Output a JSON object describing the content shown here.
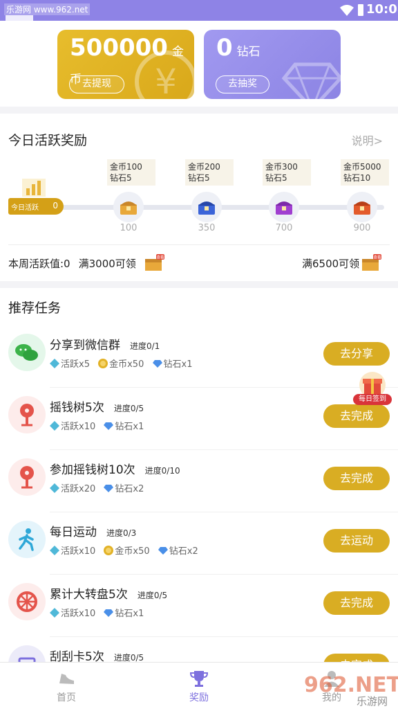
{
  "status_bar": {
    "watermark": "乐游网 www.962.net",
    "time": "10:08"
  },
  "wallet": {
    "coins": {
      "amount": "500000",
      "unit": "金币",
      "button": "去提现"
    },
    "diamonds": {
      "amount": "0",
      "unit": "钻石",
      "button": "去抽奖"
    }
  },
  "daily": {
    "title": "今日活跃奖励",
    "help": "说明>",
    "today_label": "今日活跃",
    "today_value": "0",
    "milestones": [
      {
        "coins": "金币100",
        "diamonds": "钻石5",
        "value": "100",
        "chest_color": "#e8a83a"
      },
      {
        "coins": "金币200",
        "diamonds": "钻石5",
        "value": "350",
        "chest_color": "#3b64d8"
      },
      {
        "coins": "金币300",
        "diamonds": "钻石5",
        "value": "700",
        "chest_color": "#a03fd0"
      },
      {
        "coins": "金币5000",
        "diamonds": "钻石10",
        "value": "900",
        "chest_color": "#e35a2b"
      }
    ],
    "weekly_label": "本周活跃值:0",
    "weekly_goal_1": "满3000可领",
    "weekly_goal_2": "满6500可领",
    "gift_badge": "查看"
  },
  "tasks": {
    "title": "推荐任务",
    "items": [
      {
        "name": "分享到微信群",
        "progress": "进度0/1",
        "rewards": [
          "活跃x5",
          "金币x50",
          "钻石x1"
        ],
        "reward_icons": [
          "activity-icon",
          "coin-icon",
          "diamond-icon"
        ],
        "button": "去分享",
        "icon": "wechat-icon",
        "icon_bg": "#e4f7ea"
      },
      {
        "name": "摇钱树5次",
        "progress": "进度0/5",
        "rewards": [
          "活跃x10",
          "钻石x1"
        ],
        "reward_icons": [
          "activity-icon",
          "diamond-icon"
        ],
        "button": "去完成",
        "icon": "money-tree-icon",
        "icon_bg": "#fdeceb"
      },
      {
        "name": "参加摇钱树10次",
        "progress": "进度0/10",
        "rewards": [
          "活跃x20",
          "钻石x2"
        ],
        "reward_icons": [
          "activity-icon",
          "diamond-icon"
        ],
        "button": "去完成",
        "icon": "money-tree-icon",
        "icon_bg": "#fdeceb"
      },
      {
        "name": "每日运动",
        "progress": "进度0/3",
        "rewards": [
          "活跃x10",
          "金币x50",
          "钻石x2"
        ],
        "reward_icons": [
          "activity-icon",
          "coin-icon",
          "diamond-icon"
        ],
        "button": "去运动",
        "icon": "running-icon",
        "icon_bg": "#e4f4fb"
      },
      {
        "name": "累计大转盘5次",
        "progress": "进度0/5",
        "rewards": [
          "活跃x10",
          "钻石x1"
        ],
        "reward_icons": [
          "activity-icon",
          "diamond-icon"
        ],
        "button": "去完成",
        "icon": "wheel-icon",
        "icon_bg": "#fdeceb"
      },
      {
        "name": "刮刮卡5次",
        "progress": "进度0/5",
        "rewards": [],
        "reward_icons": [],
        "button": "去完成",
        "icon": "scratch-card-icon",
        "icon_bg": "#ecebf9"
      }
    ]
  },
  "float_sign": "每日签到",
  "bottom_nav": [
    {
      "label": "首页",
      "icon": "shoe-icon",
      "active": false
    },
    {
      "label": "奖励",
      "icon": "trophy-icon",
      "active": true
    },
    {
      "label": "我的",
      "icon": "user-icon",
      "active": false
    }
  ],
  "watermark_bottom": {
    "brand": "962.NET",
    "site": "乐游网"
  },
  "colors": {
    "accent": "#d9ad23",
    "purple": "#8e83e6",
    "active_nav": "#7d70de"
  }
}
